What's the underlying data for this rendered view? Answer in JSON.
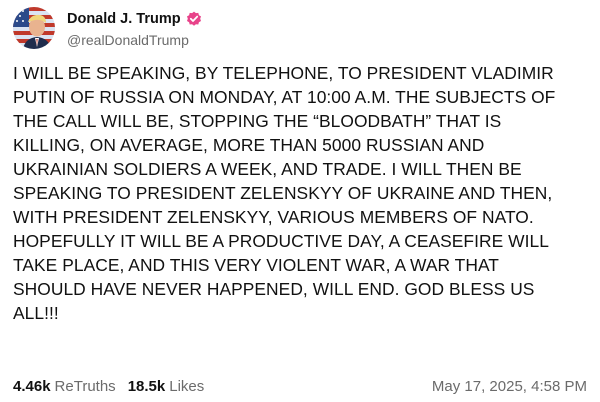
{
  "post": {
    "author": {
      "display_name": "Donald J. Trump",
      "handle": "@realDonaldTrump",
      "verified": true,
      "avatar_icon": "avatar-flag-portrait-icon",
      "verified_icon": "verified-check-icon",
      "verified_color": "#e8438a"
    },
    "text_lines": [
      "I WILL BE SPEAKING, BY TELEPHONE, TO PRESIDENT VLADIMIR",
      "PUTIN OF RUSSIA ON MONDAY, AT 10:00 A.M. THE SUBJECTS OF",
      "THE CALL WILL BE, STOPPING THE “BLOODBATH” THAT IS",
      "KILLING, ON AVERAGE, MORE THAN 5000 RUSSIAN AND",
      "UKRAINIAN SOLDIERS A WEEK, AND TRADE. I WILL THEN BE",
      "SPEAKING TO PRESIDENT ZELENSKYY OF UKRAINE AND THEN,",
      "WITH PRESIDENT ZELENSKYY, VARIOUS MEMBERS OF NATO.",
      "HOPEFULLY IT WILL BE A PRODUCTIVE DAY, A CEASEFIRE WILL",
      "TAKE PLACE, AND THIS VERY VIOLENT WAR, A WAR THAT",
      "SHOULD HAVE NEVER HAPPENED, WILL END. GOD BLESS US",
      "ALL!!!"
    ],
    "stats": {
      "retruths_count": "4.46k",
      "retruths_label": "ReTruths",
      "likes_count": "18.5k",
      "likes_label": "Likes"
    },
    "timestamp": "May 17, 2025, 4:58 PM"
  }
}
